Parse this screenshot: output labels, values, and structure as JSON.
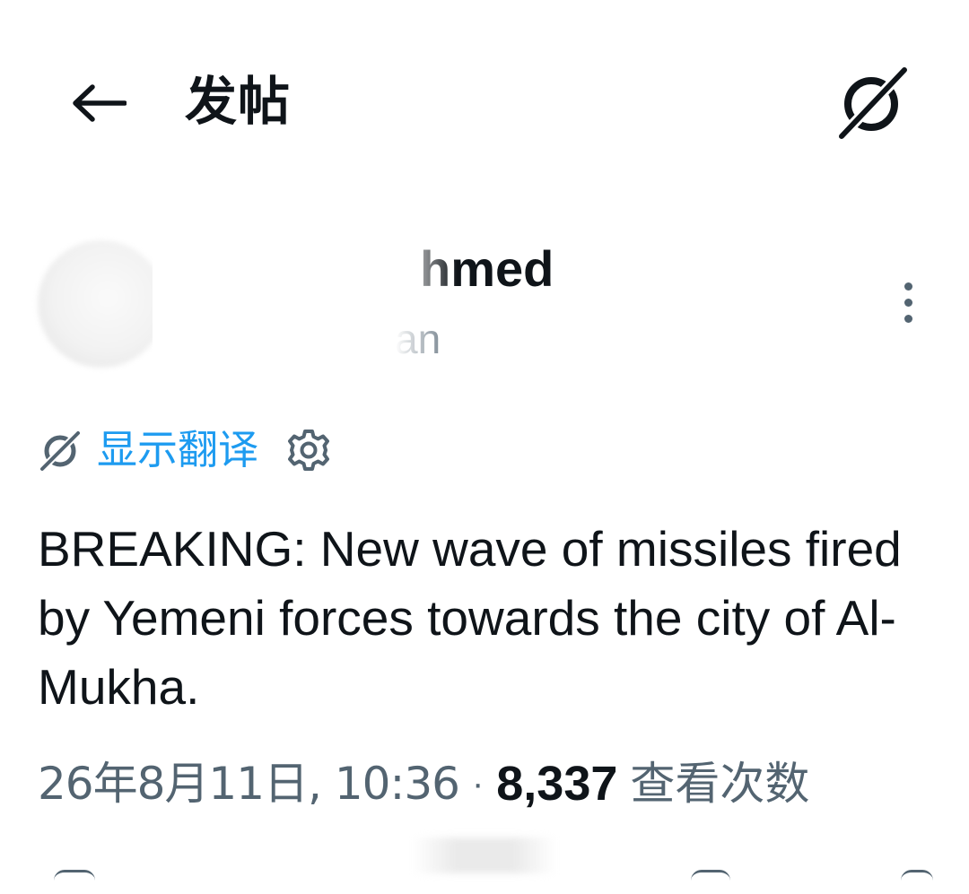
{
  "header": {
    "title": "发帖",
    "back_icon": "arrow-left-icon",
    "grok_icon": "grok-icon"
  },
  "author": {
    "display_name": "hmed",
    "handle": "an",
    "avatar_icon": "avatar"
  },
  "translate": {
    "label": "显示翻译",
    "icon": "grok-icon",
    "settings_icon": "gear-icon"
  },
  "post": {
    "text": "BREAKING: New wave of missiles fired by Yemeni forces towards the city of Al-Mukha."
  },
  "meta": {
    "timestamp": "26年8月11日, 10:36",
    "separator": "·",
    "views_count": "8,337",
    "views_label": "查看次数"
  },
  "colors": {
    "text_primary": "#0f1419",
    "text_secondary": "#536471",
    "accent": "#1d9bf0"
  }
}
